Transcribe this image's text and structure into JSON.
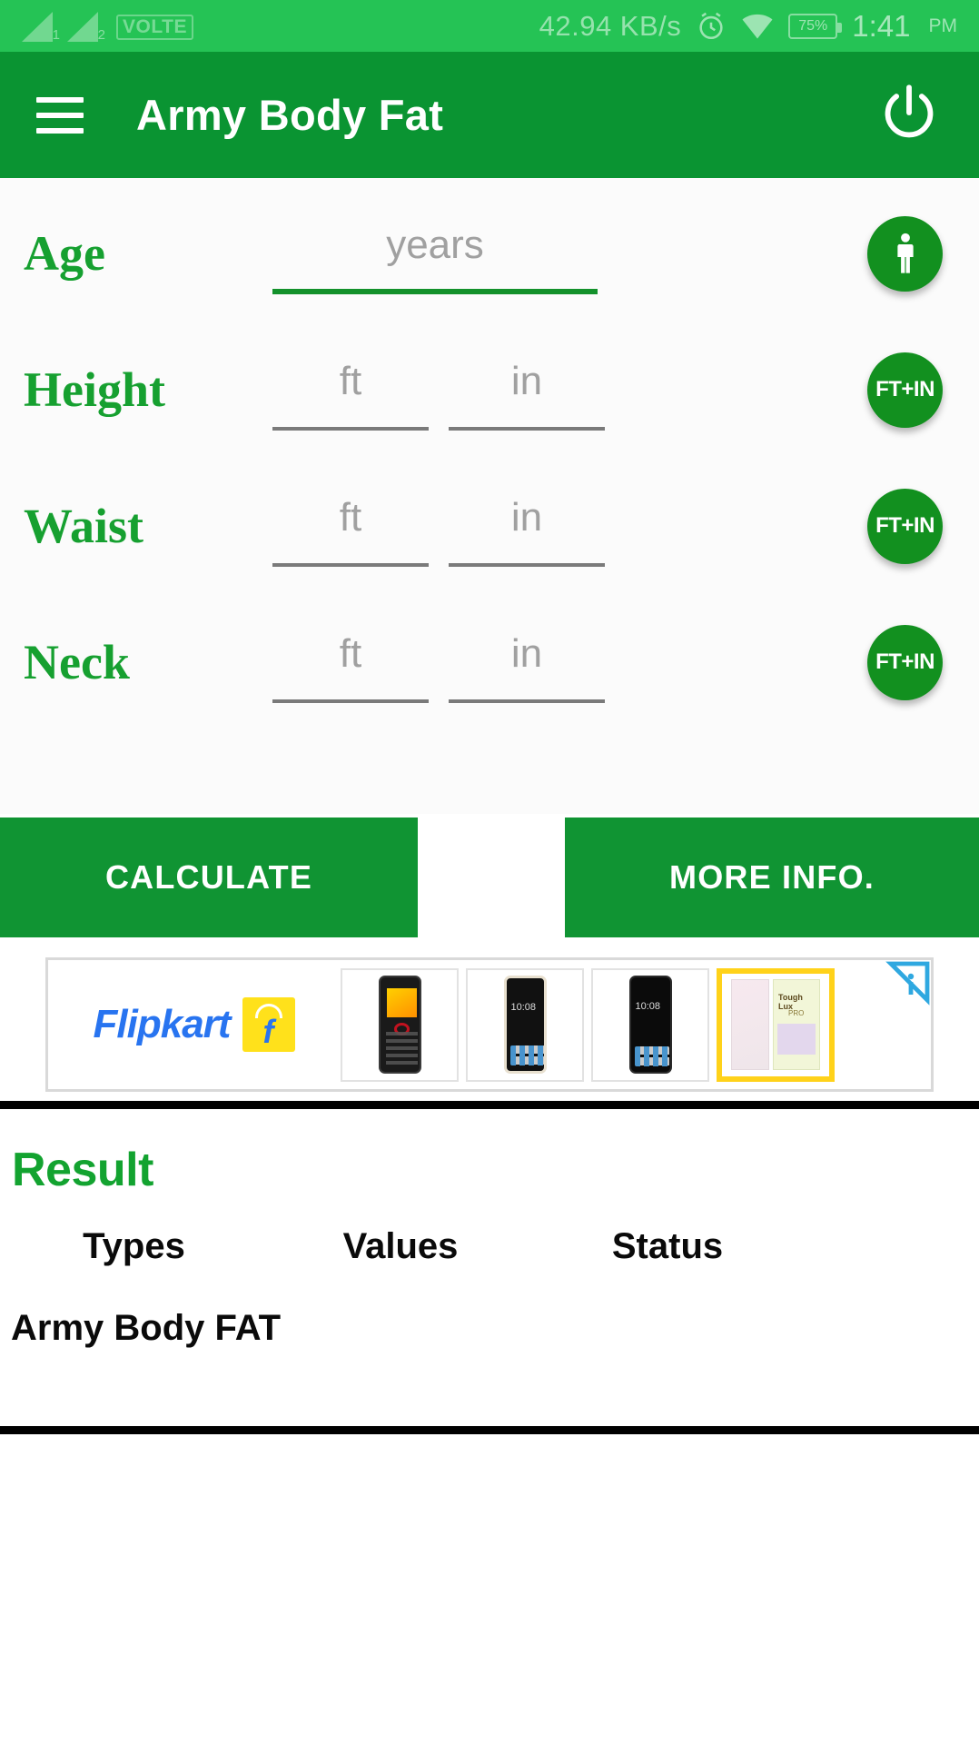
{
  "status_bar": {
    "sim1_label": "1",
    "sim2_label": "2",
    "volte": "VOLTE",
    "network_speed": "42.94 KB/s",
    "battery_percent": "75%",
    "time": "1:41",
    "ampm": "PM",
    "background_color": "#25c355"
  },
  "app_bar": {
    "title": "Army Body Fat",
    "background_color": "#0a9432",
    "menu_icon": "hamburger-menu-icon",
    "power_icon": "power-icon"
  },
  "form": {
    "rows": [
      {
        "label": "Age",
        "inputs": [
          {
            "placeholder": "years",
            "value": "",
            "focused": true
          }
        ],
        "unit_button": {
          "type": "icon",
          "icon": "male-person-icon",
          "label": ""
        }
      },
      {
        "label": "Height",
        "inputs": [
          {
            "placeholder": "ft",
            "value": "",
            "focused": false
          },
          {
            "placeholder": "in",
            "value": "",
            "focused": false
          }
        ],
        "unit_button": {
          "type": "text",
          "icon": "",
          "label": "FT+IN"
        }
      },
      {
        "label": "Waist",
        "inputs": [
          {
            "placeholder": "ft",
            "value": "",
            "focused": false
          },
          {
            "placeholder": "in",
            "value": "",
            "focused": false
          }
        ],
        "unit_button": {
          "type": "text",
          "icon": "",
          "label": "FT+IN"
        }
      },
      {
        "label": "Neck",
        "inputs": [
          {
            "placeholder": "ft",
            "value": "",
            "focused": false
          },
          {
            "placeholder": "in",
            "value": "",
            "focused": false
          }
        ],
        "unit_button": {
          "type": "text",
          "icon": "",
          "label": "FT+IN"
        }
      }
    ],
    "label_color": "#16a030"
  },
  "actions": {
    "calculate_label": "CALCULATE",
    "more_info_label": "MORE INFO.",
    "button_color": "#109433"
  },
  "ad": {
    "brand": "Flipkart",
    "brand_color": "#2874f0",
    "bag_color": "#ffe11b",
    "adchoices_icon": "adchoices-icon",
    "tiles": [
      {
        "name": "feature-phone-thumbnail",
        "highlight": false
      },
      {
        "name": "white-smartphone-thumbnail",
        "highlight": false
      },
      {
        "name": "black-smartphone-thumbnail",
        "highlight": false
      },
      {
        "name": "screen-protector-thumbnail",
        "highlight": true
      }
    ],
    "protector_text_1": "Tough Lux",
    "protector_text_2": "PRO",
    "phone_clock": "10:08"
  },
  "result": {
    "title": "Result",
    "title_color": "#13a330",
    "columns": [
      "Types",
      "Values",
      "Status"
    ],
    "rows": [
      {
        "type": "Army Body FAT",
        "value": "",
        "status": ""
      }
    ]
  }
}
